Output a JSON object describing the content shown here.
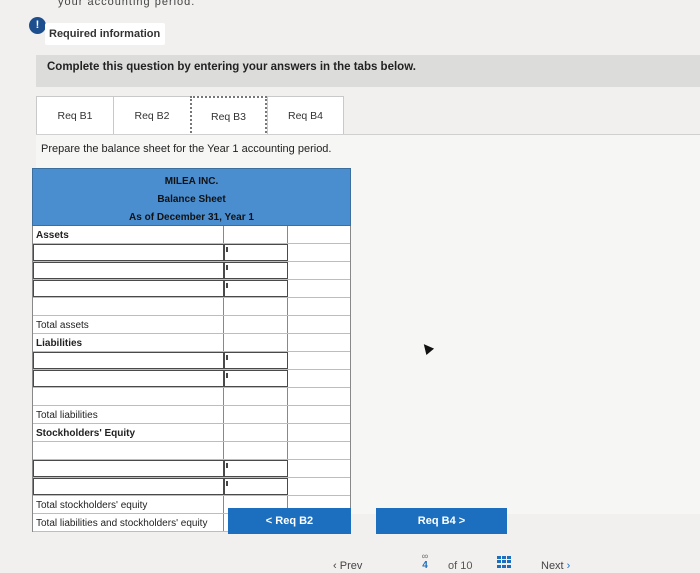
{
  "header": {
    "cut_off_text": "your accounting period.",
    "required_info_label": "Required information"
  },
  "instruction": "Complete this question by entering your answers in the tabs below.",
  "tabs": [
    {
      "label": "Req B1"
    },
    {
      "label": "Req B2"
    },
    {
      "label": "Req B3",
      "active": true
    },
    {
      "label": "Req B4"
    }
  ],
  "prompt": "Prepare the balance sheet for the Year 1 accounting period.",
  "sheet": {
    "company": "MILEA INC.",
    "statement": "Balance Sheet",
    "date": "As of December 31, Year 1",
    "rows": [
      {
        "label": "Assets",
        "kind": "section"
      },
      {
        "label": "",
        "kind": "input"
      },
      {
        "label": "",
        "kind": "input"
      },
      {
        "label": "",
        "kind": "input"
      },
      {
        "label": "",
        "kind": "blank"
      },
      {
        "label": "Total assets",
        "kind": "total"
      },
      {
        "label": "Liabilities",
        "kind": "section"
      },
      {
        "label": "",
        "kind": "input"
      },
      {
        "label": "",
        "kind": "input"
      },
      {
        "label": "",
        "kind": "blank"
      },
      {
        "label": "Total liabilities",
        "kind": "total"
      },
      {
        "label": "Stockholders' Equity",
        "kind": "section"
      },
      {
        "label": "",
        "kind": "blank"
      },
      {
        "label": "",
        "kind": "input"
      },
      {
        "label": "",
        "kind": "input"
      },
      {
        "label": "Total stockholders' equity",
        "kind": "total"
      },
      {
        "label": "Total liabilities and stockholders' equity",
        "kind": "total"
      }
    ]
  },
  "buttons": {
    "prev_req": "< Req B2",
    "next_req": "Req B4 >"
  },
  "footer": {
    "prev": "Prev",
    "page_current": "4",
    "page_of": "of 10",
    "next": "Next"
  },
  "colors": {
    "accent": "#1c6fbe",
    "sheet_header": "#4a8ed0",
    "info_icon": "#1d4f8f"
  }
}
